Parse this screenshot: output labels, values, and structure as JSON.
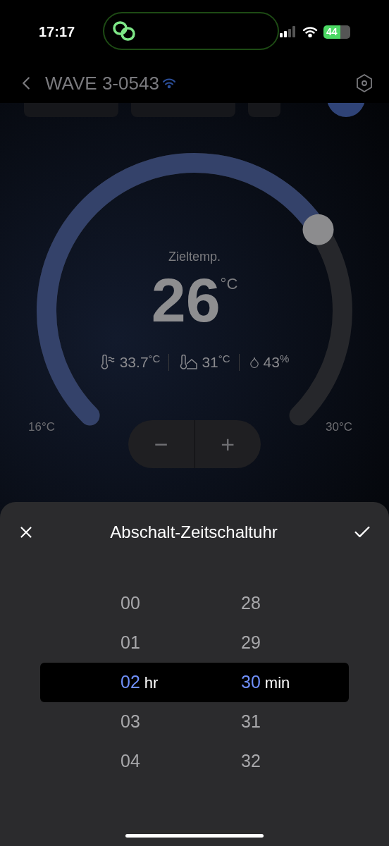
{
  "status_bar": {
    "time": "17:17",
    "battery": "44"
  },
  "header": {
    "title": "WAVE 3-0543"
  },
  "dial": {
    "label": "Zieltemp.",
    "value": "26",
    "unit": "°C",
    "min_label": "16°C",
    "max_label": "30°C",
    "readings": [
      {
        "kind": "outdoor",
        "value": "33.7",
        "unit": "°C"
      },
      {
        "kind": "indoor",
        "value": "31",
        "unit": "°C"
      },
      {
        "kind": "humidity",
        "value": "43",
        "unit": "%"
      }
    ],
    "minus": "−",
    "plus": "+"
  },
  "sheet": {
    "title": "Abschalt-Zeitschaltuhr",
    "columns": [
      {
        "unit": "hr",
        "items": [
          {
            "label": "00",
            "selected": false
          },
          {
            "label": "01",
            "selected": false
          },
          {
            "label": "02",
            "selected": true
          },
          {
            "label": "03",
            "selected": false
          },
          {
            "label": "04",
            "selected": false
          }
        ]
      },
      {
        "unit": "min",
        "items": [
          {
            "label": "28",
            "selected": false
          },
          {
            "label": "29",
            "selected": false
          },
          {
            "label": "30",
            "selected": true
          },
          {
            "label": "31",
            "selected": false
          },
          {
            "label": "32",
            "selected": false
          }
        ]
      }
    ]
  }
}
